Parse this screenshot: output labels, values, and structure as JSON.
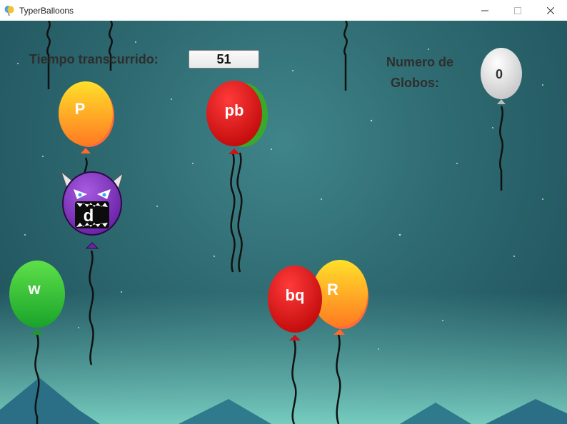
{
  "window": {
    "title": "TyperBalloons",
    "min_glyph": "—",
    "max_glyph": "☐",
    "close_glyph": "✕"
  },
  "hud": {
    "time_label": "Tiempo transcurrido:",
    "time_value": "51",
    "count_label_line1": "Numero de",
    "count_label_line2": "Globos:",
    "count_value": "0"
  },
  "balloons": [
    {
      "text": "P",
      "color": "orange"
    },
    {
      "text": "pb",
      "color": "red"
    },
    {
      "text": "d",
      "color": "purple-monster"
    },
    {
      "text": "w",
      "color": "green"
    },
    {
      "text": "bq",
      "color": "red"
    },
    {
      "text": "R",
      "color": "orange"
    }
  ],
  "colors": {
    "red": "#e01818",
    "orange": "#ffb320",
    "green": "#2ec22e",
    "purple": "#8a3fc8",
    "white": "#f2f2f2"
  }
}
